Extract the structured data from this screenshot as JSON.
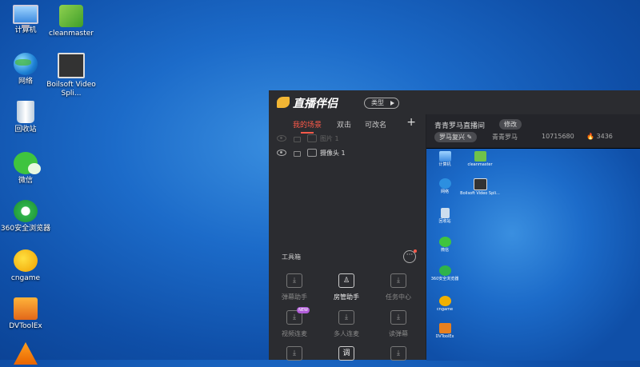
{
  "desktop": {
    "icons": [
      {
        "label": "计算机",
        "icon": "computer-icon"
      },
      {
        "label": "cleanmaster",
        "icon": "broom-icon"
      },
      {
        "label": "网络",
        "icon": "network-globe-icon"
      },
      {
        "label": "Boilsoft Video Spli...",
        "icon": "video-splitter-icon"
      },
      {
        "label": "回收站",
        "icon": "recycle-bin-icon"
      },
      {
        "label": "微信",
        "icon": "wechat-icon"
      },
      {
        "label": "360安全浏览器",
        "icon": "browser-360-icon"
      },
      {
        "label": "cngame",
        "icon": "cngame-icon"
      },
      {
        "label": "DVToolEx",
        "icon": "dvtoolex-icon"
      }
    ]
  },
  "app": {
    "title": "直播伴侣",
    "type_button": "类型",
    "scenes": {
      "tabs": [
        "我的场景",
        "双击",
        "可改名"
      ],
      "add": "+",
      "sources": [
        {
          "name": "图片 1",
          "visible": false
        },
        {
          "name": "摄像头 1",
          "visible": true
        }
      ]
    },
    "toolbox": {
      "title": "工具箱",
      "more": "···",
      "tools": [
        {
          "label": "弹幕助手",
          "icon": "download-icon"
        },
        {
          "label": "房管助手",
          "icon": "room-manager-icon"
        },
        {
          "label": "任务中心",
          "icon": "download-icon"
        },
        {
          "label": "视频连麦",
          "icon": "download-icon",
          "badge": "NEW"
        },
        {
          "label": "多人连麦",
          "icon": "download-icon"
        },
        {
          "label": "读弹幕",
          "icon": "download-icon"
        },
        {
          "label": "",
          "icon": "download-icon"
        },
        {
          "label": "",
          "icon": "tune-icon",
          "glyph": "调"
        },
        {
          "label": "",
          "icon": "download-icon"
        }
      ]
    },
    "room": {
      "title": "青青罗马直播间",
      "edit": "修改",
      "tag": "罗马复兴",
      "anchor": "青青罗马",
      "id": "10715680",
      "heat": "3436"
    }
  },
  "colors": {
    "accent": "#ff5a4a",
    "panel": "#2b2c30",
    "desktop": "#1c6bc9"
  }
}
